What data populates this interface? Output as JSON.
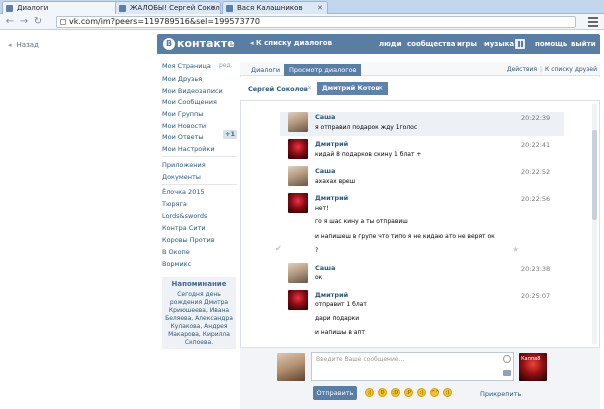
{
  "browser": {
    "tabs": [
      {
        "label": "Диалоги"
      },
      {
        "label": "ЖАЛОБЫ! Сергей Соколо"
      },
      {
        "label": "Вася Калашников"
      }
    ],
    "url": "vk.com/im?peers=119789516&sel=199573770"
  },
  "back_label": "Назад",
  "header": {
    "logo": "контакте",
    "back_to_list": "К списку диалогов",
    "nav": [
      "люди",
      "сообщества",
      "игры",
      "музыка",
      "помощь",
      "выйти"
    ]
  },
  "left_menu": {
    "main": [
      "Моя Страница",
      "Мои Друзья",
      "Мои Видеозаписи",
      "Мои Сообщения",
      "Мои Группы",
      "Мои Новости",
      "Мои Ответы",
      "Мои Настройки"
    ],
    "edit_label": "ред.",
    "answers_badge": "+1",
    "extra": [
      "Приложения",
      "Документы"
    ],
    "apps": [
      "Ёлочка 2015",
      "Тюряга",
      "Lords&swords",
      "Контра Сити",
      "Коровы Против",
      "В Окопе",
      "Вормикс"
    ],
    "reminder": {
      "title": "Напоминание",
      "body": "Сегодня день рождения Дмитра Криюшеева, Ивана Беляева, Александра Кулакова, Андрея Макарова, Кирилла Скпоева."
    }
  },
  "panel": {
    "tabs": [
      "Диалоги",
      "Просмотр диалогов"
    ],
    "actions": "Действия",
    "to_friends": "К списку друзей",
    "people": [
      "Сергей Соколов",
      "Дмитрий Котов"
    ]
  },
  "messages": [
    {
      "author": "Саша",
      "time": "20:22:39",
      "lines": [
        "я отправил подарок жду 1голос"
      ]
    },
    {
      "author": "Дмитрий",
      "time": "20:22:41",
      "lines": [
        "кидай 8 подарков скину 1 блат +"
      ]
    },
    {
      "author": "Саша",
      "time": "20:22:52",
      "lines": [
        "ахахах вреш"
      ]
    },
    {
      "author": "Дмитрий",
      "time": "20:22:56",
      "lines": [
        "нет!",
        "го я шас кину а ты отправиш",
        "и напишеш в групе что типо я не кидаю ато не верят ок",
        "?"
      ]
    },
    {
      "author": "Саша",
      "time": "20:23:38",
      "lines": [
        "ок"
      ]
    },
    {
      "author": "Дмитрий",
      "time": "20:25:07",
      "lines": [
        "отправит 1 блат",
        "дари подарки",
        "и напишы в апт"
      ]
    }
  ],
  "composer": {
    "placeholder": "Введите Ваше сообщение...",
    "send_label": "Отправить",
    "attach_label": "Прикрепить",
    "their_avatar_label": "Каппа8"
  }
}
